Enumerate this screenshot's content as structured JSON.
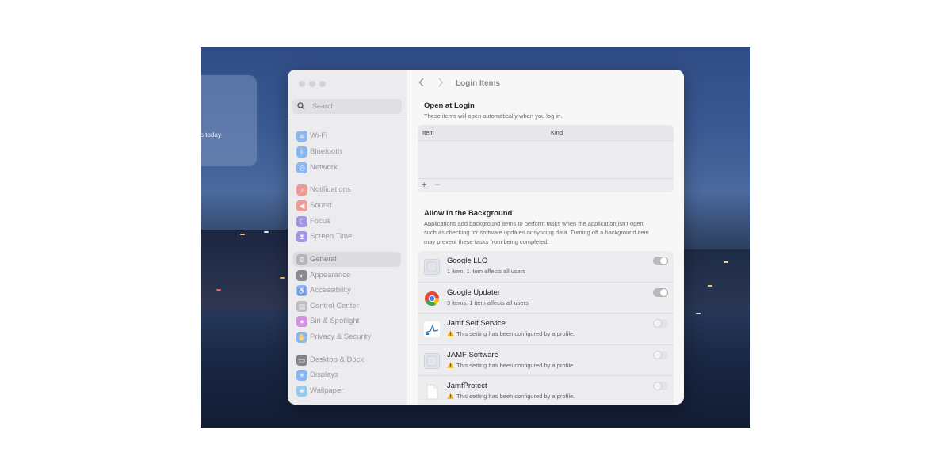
{
  "widget": {
    "text": "s today"
  },
  "sidebar": {
    "search_placeholder": "Search",
    "items": [
      {
        "label": "Wi-Fi",
        "icon": "wifi-icon",
        "color": "#4a93f2",
        "selected": false
      },
      {
        "label": "Bluetooth",
        "icon": "bluetooth-icon",
        "color": "#4a93f2",
        "selected": false
      },
      {
        "label": "Network",
        "icon": "globe-icon",
        "color": "#4a93f2",
        "selected": false
      },
      {
        "label": "Notifications",
        "icon": "bell-icon",
        "color": "#f0655b",
        "selected": false
      },
      {
        "label": "Sound",
        "icon": "speaker-icon",
        "color": "#f0655b",
        "selected": false
      },
      {
        "label": "Focus",
        "icon": "moon-icon",
        "color": "#6d5fd8",
        "selected": false
      },
      {
        "label": "Screen Time",
        "icon": "hourglass-icon",
        "color": "#6d5fd8",
        "selected": false
      },
      {
        "label": "General",
        "icon": "gear-icon",
        "color": "#9e9ea3",
        "selected": true
      },
      {
        "label": "Appearance",
        "icon": "appearance-icon",
        "color": "#4a4a4f",
        "selected": false
      },
      {
        "label": "Accessibility",
        "icon": "accessibility-icon",
        "color": "#4a93f2",
        "selected": false
      },
      {
        "label": "Control Center",
        "icon": "control-center-icon",
        "color": "#9e9ea3",
        "selected": false
      },
      {
        "label": "Siri & Spotlight",
        "icon": "siri-icon",
        "color": "#c457d8",
        "selected": false
      },
      {
        "label": "Privacy & Security",
        "icon": "hand-icon",
        "color": "#4a93f2",
        "selected": false
      },
      {
        "label": "Desktop & Dock",
        "icon": "dock-icon",
        "color": "#3f3f44",
        "selected": false
      },
      {
        "label": "Displays",
        "icon": "sun-icon",
        "color": "#4a93f2",
        "selected": false
      },
      {
        "label": "Wallpaper",
        "icon": "wallpaper-icon",
        "color": "#55b7ef",
        "selected": false
      }
    ]
  },
  "main": {
    "title": "Login Items",
    "open_at_login": {
      "title": "Open at Login",
      "subtitle": "These items will open automatically when you log in.",
      "col_item": "Item",
      "col_kind": "Kind",
      "add": "+",
      "remove": "−"
    },
    "background": {
      "title": "Allow in the Background",
      "subtitle": "Applications add background items to perform tasks when the application isn't open, such as checking for software updates or syncing data. Turning off a background item may prevent these tasks from being completed.",
      "items": [
        {
          "name": "Google LLC",
          "detail": "1 item: 1 item affects all users",
          "icon": "generic-app-icon",
          "enabled": true,
          "managed": false
        },
        {
          "name": "Google Updater",
          "detail": "3 items: 1 item affects all users",
          "icon": "chrome-icon",
          "enabled": true,
          "managed": false
        },
        {
          "name": "Jamf Self Service",
          "detail": "This setting has been configured by a profile.",
          "icon": "jamf-self-service-icon",
          "enabled": false,
          "managed": true
        },
        {
          "name": "JAMF Software",
          "detail": "This setting has been configured by a profile.",
          "icon": "generic-app-icon",
          "enabled": false,
          "managed": true
        },
        {
          "name": "JamfProtect",
          "detail": "This setting has been configured by a profile.",
          "icon": "document-icon",
          "enabled": false,
          "managed": true
        }
      ]
    }
  },
  "colors": {
    "warning": "#f5b40a",
    "toggle_on": "#b9b9bd"
  }
}
